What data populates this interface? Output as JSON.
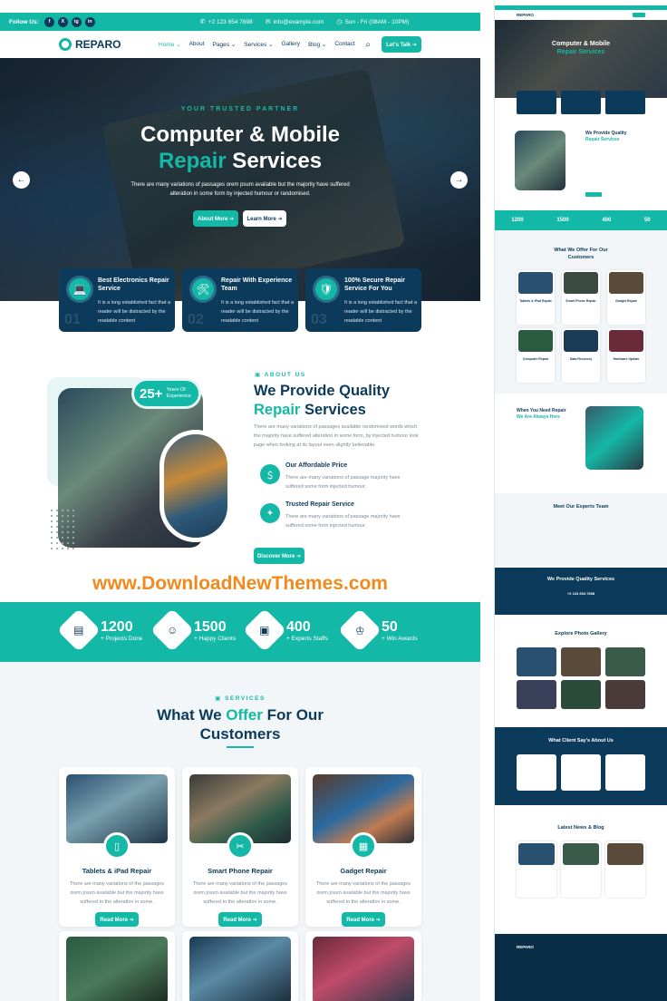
{
  "topbar": {
    "follow_label": "Follow Us:",
    "social": [
      "f",
      "X",
      "ig",
      "in"
    ],
    "phone": "+2 123 654 7898",
    "email": "info@example.com",
    "hours": "Sun - Fri (08AM - 10PM)"
  },
  "nav": {
    "logo": "REPARO",
    "items": [
      "Home ⌄",
      "About",
      "Pages ⌄",
      "Services ⌄",
      "Gallery",
      "Blog ⌄",
      "Contact"
    ],
    "cta": "Let's Talk ➔"
  },
  "hero": {
    "kicker": "YOUR TRUSTED PARTNER",
    "title_line1": "Computer & Mobile",
    "title_hl": "Repair",
    "title_line2_rest": " Services",
    "desc": "There are many variations of passages orem psum available but the majority have suffered alteration in some form by injected humour or randomised.",
    "btn_about": "About More ➔",
    "btn_learn": "Learn More ➔"
  },
  "features": [
    {
      "title": "Best Electronics Repair Service",
      "desc": "It is a long established fact that a reader will be distracted by the readable content",
      "num": "01",
      "icon": "laptop-icon"
    },
    {
      "title": "Repair With Experience Team",
      "desc": "It is a long established fact that a reader will be distracted by the readable content",
      "num": "02",
      "icon": "technician-icon"
    },
    {
      "title": "100% Secure Repair Service For You",
      "desc": "It is a long established fact that a reader will be distracted by the readable content",
      "num": "03",
      "icon": "shield-icon"
    }
  ],
  "about": {
    "badge_num": "25+",
    "badge_text": "Years Of Experience",
    "kicker": "ABOUT US",
    "title_line1": "We Provide Quality",
    "title_hl": "Repair",
    "title_line2_rest": " Services",
    "desc": "There are many variations of passages available randomised words which the majority have suffered alteration in some form, by injected humour look page when looking at its layout even slightly believable.",
    "items": [
      {
        "title": "Our Affordable Price",
        "desc": "There are many variations of passage majority have suffered some form injected humour."
      },
      {
        "title": "Trusted Repair Service",
        "desc": "There are many variations of passage majority have suffered some form injected humour."
      }
    ],
    "btn": "Discover More ➔"
  },
  "watermark": "www.DownloadNewThemes.com",
  "stats": [
    {
      "num": "1200",
      "label": "+ Projects Done"
    },
    {
      "num": "1500",
      "label": "+ Happy Clients"
    },
    {
      "num": "400",
      "label": "+ Experts Staffs"
    },
    {
      "num": "50",
      "label": "+ Win Awards"
    }
  ],
  "services": {
    "kicker": "SERVICES",
    "title_line1_a": "What We ",
    "title_hl": "Offer",
    "title_line1_b": " For Our",
    "title_line2": "Customers",
    "cards": [
      {
        "title": "Tablets & iPad Repair",
        "desc": "There are many variations of the passages orem psum available but the majority have suffered to the alteration in some.",
        "btn": "Read More ➔"
      },
      {
        "title": "Smart Phone Repair",
        "desc": "There are many variations of the passages orem psum available but the majority have suffered to the alteration in some.",
        "btn": "Read More ➔"
      },
      {
        "title": "Gadget Repair",
        "desc": "There are many variations of the passages orem psum available but the majority have suffered to the alteration in some.",
        "btn": "Read More ➔"
      }
    ]
  },
  "side": {
    "hero_title1": "Computer & Mobile",
    "hero_title2": "Repair Services",
    "about_title1": "We Provide Quality",
    "about_title2": "Repair Services",
    "stats": [
      "1200",
      "1500",
      "400",
      "50"
    ],
    "offer_title1": "What We Offer For Our",
    "offer_title2": "Customers",
    "offer_cards": [
      "Tablets & iPad Repair",
      "Smart Phone Repair",
      "Gadget Repair",
      "Computer Repair",
      "Data Recovery",
      "Hardware Update"
    ],
    "need_title1": "When You Need Repair",
    "need_title2": "We Are Always Here",
    "team_title": "Meet Our Experts Team",
    "cta_title": "We Provide Quality Services",
    "cta_phone": "+2 123 654 7898",
    "gallery_title": "Explore Photo Gallery",
    "testimonial_title": "What Client Say's About Us",
    "news_title": "Latest News & Blog",
    "footer_logo": "REPARO"
  }
}
